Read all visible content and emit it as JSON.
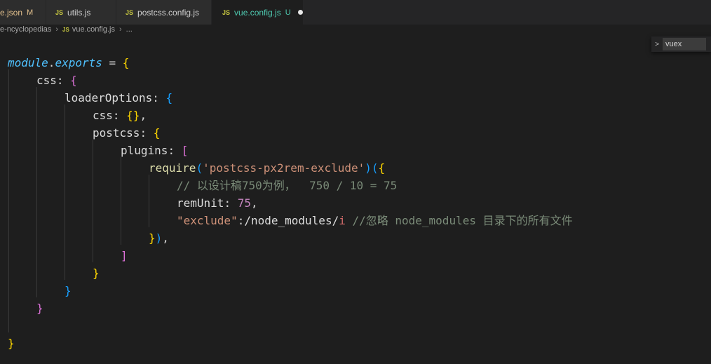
{
  "tabs": [
    {
      "label": "e.json",
      "mark": "M",
      "icon": ""
    },
    {
      "label": "utils.js",
      "mark": "",
      "icon": "JS"
    },
    {
      "label": "postcss.config.js",
      "mark": "",
      "icon": "JS"
    },
    {
      "label": "vue.config.js",
      "mark": "U",
      "icon": "JS"
    }
  ],
  "breadcrumb": {
    "folder": "e-ncyclopedias",
    "file_icon": "JS",
    "file": "vue.config.js",
    "more": "..."
  },
  "find": {
    "chevron": ">",
    "value": "vuex"
  },
  "code": {
    "l1_obj": "module",
    "l1_dot": ".",
    "l1_exports": "exports",
    "l1_eq": " = ",
    "l1_br": "{",
    "l2_key": "css",
    "l2_colon": ": ",
    "l2_br": "{",
    "l3_key": "loaderOptions",
    "l3_colon": ": ",
    "l3_br": "{",
    "l4_key": "css",
    "l4_colon": ": ",
    "l4_br": "{}",
    "l4_comma": ",",
    "l5_key": "postcss",
    "l5_colon": ": ",
    "l5_br": "{",
    "l6_key": "plugins",
    "l6_colon": ": ",
    "l6_br": "[",
    "l7_fn": "require",
    "l7_p1": "(",
    "l7_str": "'postcss-px2rem-exclude'",
    "l7_p2": ")",
    "l7_p3": "(",
    "l7_br": "{",
    "l8_cmt": "// 以设计稿750为例，  750 / 10 = 75",
    "l9_key": "remUnit",
    "l9_colon": ": ",
    "l9_num": "75",
    "l9_comma": ",",
    "l10_key": "\"exclude\"",
    "l10_colon": ":",
    "l10_regex": "/node_modules/",
    "l10_flag": "i",
    "l10_cmt": " //忽略 node_modules 目录下的所有文件",
    "l11_br": "}",
    "l11_p": ")",
    "l11_comma": ",",
    "l12_br": "]",
    "l13_br": "}",
    "l14_br": "}",
    "l15_br": "}",
    "l17_br": "}"
  }
}
